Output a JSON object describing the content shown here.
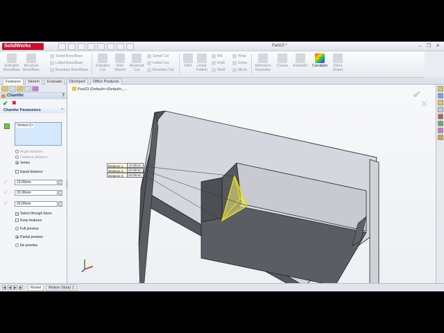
{
  "app": {
    "logo_text": "SolidWorks",
    "document_title": "Part23 *"
  },
  "window_controls": {
    "minimize": "–",
    "restore": "❐",
    "close": "✕"
  },
  "command_manager": {
    "big_buttons": [
      {
        "label": "Extruded Boss/Base"
      },
      {
        "label": "Revolved Boss/Base"
      },
      {
        "label": "Extruded Cut"
      },
      {
        "label": "Hole Wizard"
      },
      {
        "label": "Revolved Cut"
      },
      {
        "label": "Fillet"
      },
      {
        "label": "Linear Pattern"
      },
      {
        "label": "Reference Geometry"
      },
      {
        "label": "Curves"
      },
      {
        "label": "Instant3D"
      },
      {
        "label": "Curvature"
      },
      {
        "label": "Zebra Stripes"
      }
    ],
    "small_buttons": [
      {
        "label": "Swept Boss/Base"
      },
      {
        "label": "Lofted Boss/Base"
      },
      {
        "label": "Boundary Boss/Base"
      },
      {
        "label": "Swept Cut"
      },
      {
        "label": "Lofted Cut"
      },
      {
        "label": "Boundary Cut"
      },
      {
        "label": "Rib"
      },
      {
        "label": "Draft"
      },
      {
        "label": "Shell"
      },
      {
        "label": "Wrap"
      },
      {
        "label": "Dome"
      },
      {
        "label": "Mirror"
      }
    ]
  },
  "tabs": [
    {
      "label": "Features",
      "active": true
    },
    {
      "label": "Sketch"
    },
    {
      "label": "Evaluate"
    },
    {
      "label": "DimXpert"
    },
    {
      "label": "Office Products"
    }
  ],
  "property_manager": {
    "title": "Chamfer",
    "help": "?",
    "ok": "✔",
    "cancel": "✖",
    "group_title": "Chamfer Parameters",
    "collapse": "⌃",
    "selection_item": "Vertex<1>",
    "options": {
      "angle_distance": "Angle distance",
      "distance_distance": "Distance distance",
      "vertex": "Vertex",
      "equal_distance": "Equal distance"
    },
    "distances": [
      "10.00mm",
      "20.00mm",
      "20.00mm"
    ],
    "spin_up": "▲",
    "spin_down": "▼",
    "checkboxes": {
      "select_through_faces": "Select through faces",
      "keep_features": "Keep features"
    },
    "preview": {
      "full": "Full preview",
      "partial": "Partial preview",
      "none": "No preview"
    },
    "selected_option": "vertex",
    "selected_preview": "partial"
  },
  "graphics": {
    "breadcrumb": "Part23  (Default<<Default>_...",
    "ghost_ok": "✔",
    "ghost_cancel": "✕",
    "callout": [
      {
        "label": "Distance 1:",
        "value": "10.00mm"
      },
      {
        "label": "Distance 2:",
        "value": "20.00mm"
      },
      {
        "label": "Distance 3:",
        "value": "20.00mm"
      }
    ],
    "highlight_color": "#e8e000"
  },
  "bottom_tabs": {
    "model": "Model",
    "motion_study": "Motion Study 1",
    "arrows": [
      "◀",
      "◀",
      "▶",
      "▶"
    ]
  }
}
